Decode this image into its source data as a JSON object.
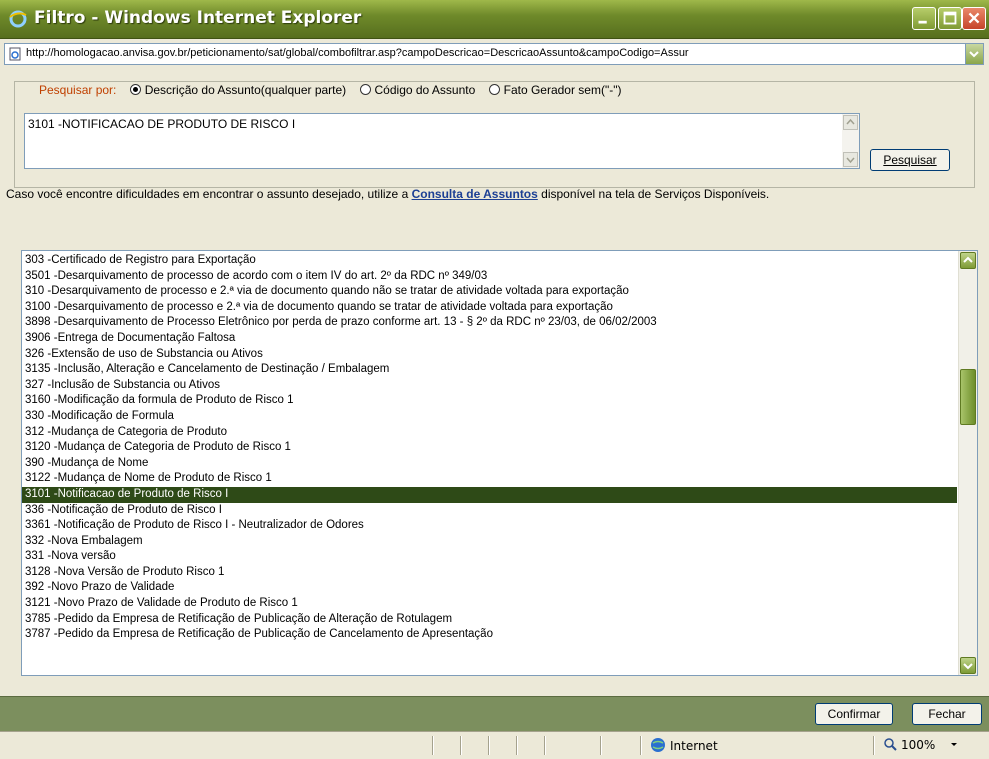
{
  "window": {
    "title": "Filtro - Windows Internet Explorer"
  },
  "address": {
    "url": "http://homologacao.anvisa.gov.br/peticionamento/sat/global/combofiltrar.asp?campoDescricao=DescricaoAssunto&campoCodigo=Assur"
  },
  "search": {
    "label": "Pesquisar por:",
    "options": [
      {
        "label": "Descrição do Assunto(qualquer parte)",
        "selected": true
      },
      {
        "label": "Código do Assunto",
        "selected": false
      },
      {
        "label": "Fato Gerador sem(\"-\")",
        "selected": false
      }
    ],
    "value": "3101 -NOTIFICACAO DE PRODUTO DE RISCO I",
    "button": "Pesquisar"
  },
  "hint": {
    "before": "Caso você encontre dificuldades em encontrar o assunto desejado, utilize a ",
    "link": "Consulta de Assuntos",
    "after": " disponível na tela de Serviços Disponíveis."
  },
  "list": {
    "selected_index": 16,
    "items": [
      "303 -Certificado de Registro para Exportação",
      "3501 -Desarquivamento de processo de acordo com o item IV do art. 2º da RDC nº 349/03",
      "310 -Desarquivamento de processo e 2.ª via de documento quando não se tratar de atividade voltada para exportação",
      "3100 -Desarquivamento de processo e 2.ª via de documento quando se tratar de atividade voltada para exportação",
      "3898 -Desarquivamento de Processo Eletrônico por perda de prazo conforme art. 13 - § 2º da RDC nº 23/03, de 06/02/2003",
      "3906 -Entrega de Documentação Faltosa",
      "326 -Extensão de uso de Substancia ou Ativos",
      "3135 -Inclusão, Alteração e Cancelamento de Destinação / Embalagem",
      "327 -Inclusão de Substancia ou Ativos",
      "3160 -Modificação da formula de Produto de Risco 1",
      "330 -Modificação de Formula",
      "312 -Mudança de Categoria de Produto",
      "3120 -Mudança de Categoria de Produto de Risco 1",
      "390 -Mudança de Nome",
      "3122 -Mudança de Nome de Produto de Risco 1",
      "3101 -Notificacao de Produto de Risco I",
      "336 -Notificação de Produto de Risco I",
      "3361 -Notificação de Produto de Risco I - Neutralizador de Odores",
      "332 -Nova Embalagem",
      "331 -Nova versão",
      "3128 -Nova Versão de Produto Risco 1",
      "392 -Novo Prazo de Validade",
      "3121 -Novo Prazo de Validade de Produto de Risco 1",
      "3785 -Pedido da Empresa de Retificação de Publicação de Alteração de Rotulagem",
      "3787 -Pedido da Empresa de Retificação de Publicação de Cancelamento de Apresentação"
    ]
  },
  "buttons": {
    "confirm": "Confirmar",
    "close": "Fechar"
  },
  "status": {
    "zone": "Internet",
    "zoom": "100%"
  },
  "colors": {
    "titlebar": "#6f8a2a",
    "selection": "#2e4a17",
    "buttonbar": "#7c8f5e",
    "link": "#1c3f94"
  }
}
